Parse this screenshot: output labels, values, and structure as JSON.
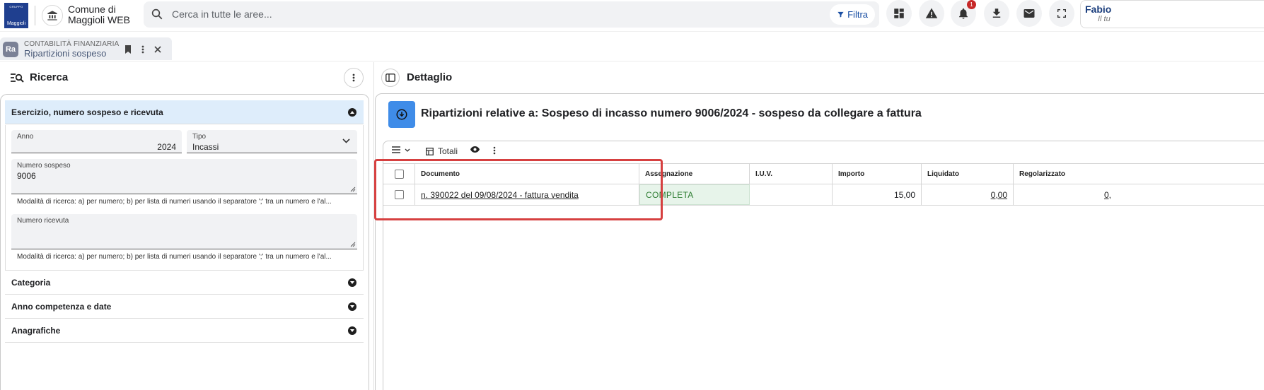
{
  "header": {
    "logo_sub": "GRUPPO",
    "logo_text": "Maggioli",
    "app_name_line1": "Comune di",
    "app_name_line2": "Maggioli WEB",
    "search_placeholder": "Cerca in tutte le aree...",
    "filter_label": "Filtra",
    "notification_count": "1",
    "user_name": "Fabio",
    "user_sub": "Il tu"
  },
  "tab": {
    "avatar": "Ra",
    "module": "CONTABILITÀ FINANZIARIA",
    "title": "Ripartizioni sospeso"
  },
  "left": {
    "title": "Ricerca",
    "section_active": "Esercizio, numero sospeso e ricevuta",
    "fields": {
      "anno_label": "Anno",
      "anno_value": "2024",
      "tipo_label": "Tipo",
      "tipo_value": "Incassi",
      "numero_sospeso_label": "Numero sospeso",
      "numero_sospeso_value": "9006",
      "numero_ricevuta_label": "Numero ricevuta",
      "numero_ricevuta_value": ""
    },
    "hint": "Modalità di ricerca: a) per numero; b) per lista di numeri usando il separatore ';' tra un numero e l'al...",
    "sections": [
      "Categoria",
      "Anno competenza e date",
      "Anagrafiche"
    ]
  },
  "right": {
    "title": "Dettaglio",
    "detail_title": "Ripartizioni relative a: Sospeso di incasso numero 9006/2024 - sospeso da collegare a fattura",
    "toolbar_totali": "Totali",
    "columns": [
      "Documento",
      "Assegnazione",
      "I.U.V.",
      "Importo",
      "Liquidato",
      "Regolarizzato"
    ],
    "rows": [
      {
        "documento": "n. 390022 del 09/08/2024 - fattura vendita",
        "assegnazione": "COMPLETA",
        "iuv": "",
        "importo": "15,00",
        "liquidato": "0,00",
        "regolarizzato": "0,"
      }
    ]
  },
  "colors": {
    "accent": "#3f8ce8",
    "brand": "#1f3f8f",
    "highlight": "#d64040",
    "active_section": "#deedfb"
  }
}
